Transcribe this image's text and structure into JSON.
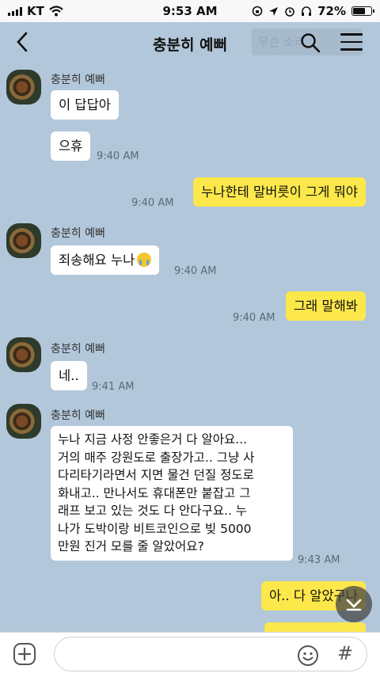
{
  "status": {
    "carrier": "KT",
    "time": "9:53 AM",
    "battery": "72%",
    "battery_level": 0.72
  },
  "header": {
    "back_icon": "chevron-left-icon",
    "title": "충분히 예뻐",
    "search_placeholder": "무슨 소리",
    "search_icon": "search-icon",
    "menu_icon": "hamburger-menu-icon"
  },
  "messages": [
    {
      "side": "in",
      "sender": "충분히 예뻐",
      "text": "이 답답아"
    },
    {
      "side": "in",
      "text": "으휴",
      "time": "9:40 AM"
    },
    {
      "side": "out",
      "text": "누나한테 말버릇이 그게 뭐야",
      "time": "9:40 AM"
    },
    {
      "side": "in",
      "sender": "충분히 예뻐",
      "text": "죄송해요 누나",
      "time": "9:40 AM",
      "emoji": "crying-face-emoji"
    },
    {
      "side": "out",
      "text": "그래 말해봐",
      "time": "9:40 AM"
    },
    {
      "side": "in",
      "sender": "충분히 예뻐",
      "text": "네..",
      "time": "9:41 AM"
    },
    {
      "side": "in",
      "sender": "충분히 예뻐",
      "lines": [
        "누나 지금 사정 안좋은거 다 알아요...",
        "거의 매주 강원도로 출장가고.. 그냥 사",
        "다리타기라면서 지면 물건 던질 정도로",
        "화내고.. 만나서도 휴대폰만 붙잡고 그",
        "래프 보고 있는 것도 다 안다구요.. 누",
        "나가 도박이랑 비트코인으로 빚 5000",
        "만원 진거 모를 줄 알았어요?"
      ],
      "time": "9:43 AM"
    },
    {
      "side": "out",
      "text": "아.. 다 알았구나"
    }
  ],
  "input": {
    "placeholder": "",
    "plus_icon": "plus-icon",
    "emoji_icon": "emoji-icon",
    "hash_icon": "hash-icon",
    "hash_label": "#"
  },
  "colors": {
    "background": "#b2c7da",
    "my_bubble": "#fde84b",
    "their_bubble": "#ffffff"
  }
}
